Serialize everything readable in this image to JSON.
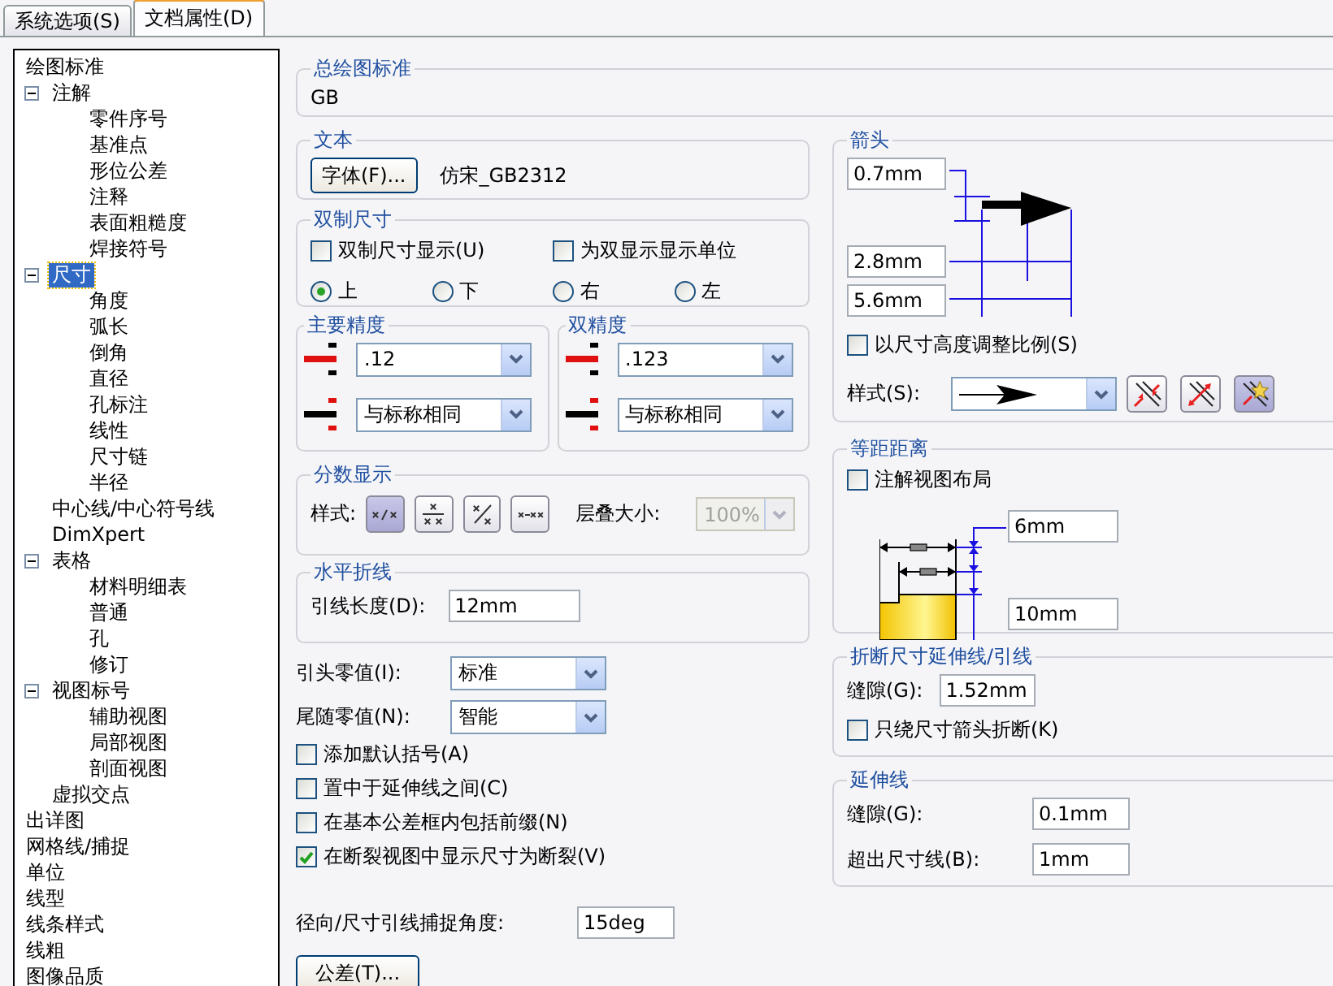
{
  "tabs": [
    {
      "label": "系统选项(S)",
      "selected": false
    },
    {
      "label": "文档属性(D)",
      "selected": true
    }
  ],
  "tree": [
    {
      "label": "绘图标准",
      "selected": false,
      "children": [
        {
          "label": "注解",
          "selected": false,
          "expanded": true,
          "children": [
            {
              "label": "零件序号",
              "selected": false
            },
            {
              "label": "基准点",
              "selected": false
            },
            {
              "label": "形位公差",
              "selected": false
            },
            {
              "label": "注释",
              "selected": false
            },
            {
              "label": "表面粗糙度",
              "selected": false
            },
            {
              "label": "焊接符号",
              "selected": false
            }
          ]
        },
        {
          "label": "尺寸",
          "selected": true,
          "expanded": true,
          "children": [
            {
              "label": "角度",
              "selected": false
            },
            {
              "label": "弧长",
              "selected": false
            },
            {
              "label": "倒角",
              "selected": false
            },
            {
              "label": "直径",
              "selected": false
            },
            {
              "label": "孔标注",
              "selected": false
            },
            {
              "label": "线性",
              "selected": false
            },
            {
              "label": "尺寸链",
              "selected": false
            },
            {
              "label": "半径",
              "selected": false
            }
          ]
        },
        {
          "label": "中心线/中心符号线",
          "selected": false
        },
        {
          "label": "DimXpert",
          "selected": false
        },
        {
          "label": "表格",
          "selected": false,
          "expanded": true,
          "children": [
            {
              "label": "材料明细表",
              "selected": false
            },
            {
              "label": "普通",
              "selected": false
            },
            {
              "label": "孔",
              "selected": false
            },
            {
              "label": "修订",
              "selected": false
            }
          ]
        },
        {
          "label": "视图标号",
          "selected": false,
          "expanded": true,
          "children": [
            {
              "label": "辅助视图",
              "selected": false
            },
            {
              "label": "局部视图",
              "selected": false
            },
            {
              "label": "剖面视图",
              "selected": false
            }
          ]
        },
        {
          "label": "虚拟交点",
          "selected": false
        }
      ]
    },
    {
      "label": "出详图",
      "selected": false
    },
    {
      "label": "网格线/捕捉",
      "selected": false
    },
    {
      "label": "单位",
      "selected": false
    },
    {
      "label": "线型",
      "selected": false
    },
    {
      "label": "线条样式",
      "selected": false
    },
    {
      "label": "线粗",
      "selected": false
    },
    {
      "label": "图像品质",
      "selected": false
    }
  ],
  "drawing_standard": {
    "title": "总绘图标准",
    "value": "GB"
  },
  "text": {
    "title": "文本",
    "font_button": "字体(F)...",
    "font_name": "仿宋_GB2312"
  },
  "dual_dimensions": {
    "title": "双制尺寸",
    "checkboxes": [
      {
        "label": "双制尺寸显示(U)",
        "checked": false
      },
      {
        "label": "为双显示显示单位",
        "checked": false
      }
    ],
    "radios": [
      {
        "label": "上",
        "selected": true
      },
      {
        "label": "下",
        "selected": false
      },
      {
        "label": "右",
        "selected": false
      },
      {
        "label": "左",
        "selected": false
      }
    ]
  },
  "precision": [
    {
      "title": "主要精度",
      "values": [
        ".12",
        "与标称相同"
      ]
    },
    {
      "title": "双精度",
      "values": [
        ".123",
        "与标称相同"
      ]
    }
  ],
  "fraction": {
    "title": "分数显示",
    "style_label": "样式:",
    "styles": [
      {
        "kind": "inline",
        "selected": true
      },
      {
        "kind": "stacked",
        "selected": false
      },
      {
        "kind": "diagonal",
        "selected": false
      },
      {
        "kind": "dash",
        "selected": false
      }
    ],
    "stack_label": "层叠大小:",
    "stack_value": "100%",
    "stack_disabled": true
  },
  "bent_leader": {
    "title": "水平折线",
    "label": "引线长度(D):",
    "value": "12mm"
  },
  "zeroes": [
    {
      "label": "引头零值(I):",
      "value": "标准"
    },
    {
      "label": "尾随零值(N):",
      "value": "智能"
    }
  ],
  "options": [
    {
      "label": "添加默认括号(A)",
      "checked": false
    },
    {
      "label": "置中于延伸线之间(C)",
      "checked": false
    },
    {
      "label": "在基本公差框内包括前缀(N)",
      "checked": false
    },
    {
      "label": "在断裂视图中显示尺寸为断裂(V)",
      "checked": true
    }
  ],
  "snap_angle": {
    "label": "径向/尺寸引线捕捉角度:",
    "value": "15deg"
  },
  "tolerance_button": "公差(T)...",
  "arrows": {
    "title": "箭头",
    "sizes": [
      "0.7mm",
      "2.8mm",
      "5.6mm"
    ],
    "scale": {
      "label": "以尺寸高度调整比例(S)",
      "checked": false
    },
    "style_label": "样式(S):",
    "style_buttons": [
      {
        "kind": "inside",
        "selected": false
      },
      {
        "kind": "outside",
        "selected": false
      },
      {
        "kind": "smart",
        "selected": true
      }
    ]
  },
  "offset": {
    "title": "等距距离",
    "checkbox": {
      "label": "注解视图布局",
      "checked": false
    },
    "values": [
      "6mm",
      "10mm"
    ]
  },
  "break": {
    "title": "折断尺寸延伸线/引线",
    "label": "缝隙(G):",
    "value": "1.52mm",
    "checkbox": {
      "label": "只绕尺寸箭头折断(K)",
      "checked": false
    }
  },
  "extension": {
    "title": "延伸线",
    "rows": [
      {
        "label": "缝隙(G):",
        "value": "0.1mm"
      },
      {
        "label": "超出尺寸线(B):",
        "value": "1mm"
      }
    ]
  }
}
